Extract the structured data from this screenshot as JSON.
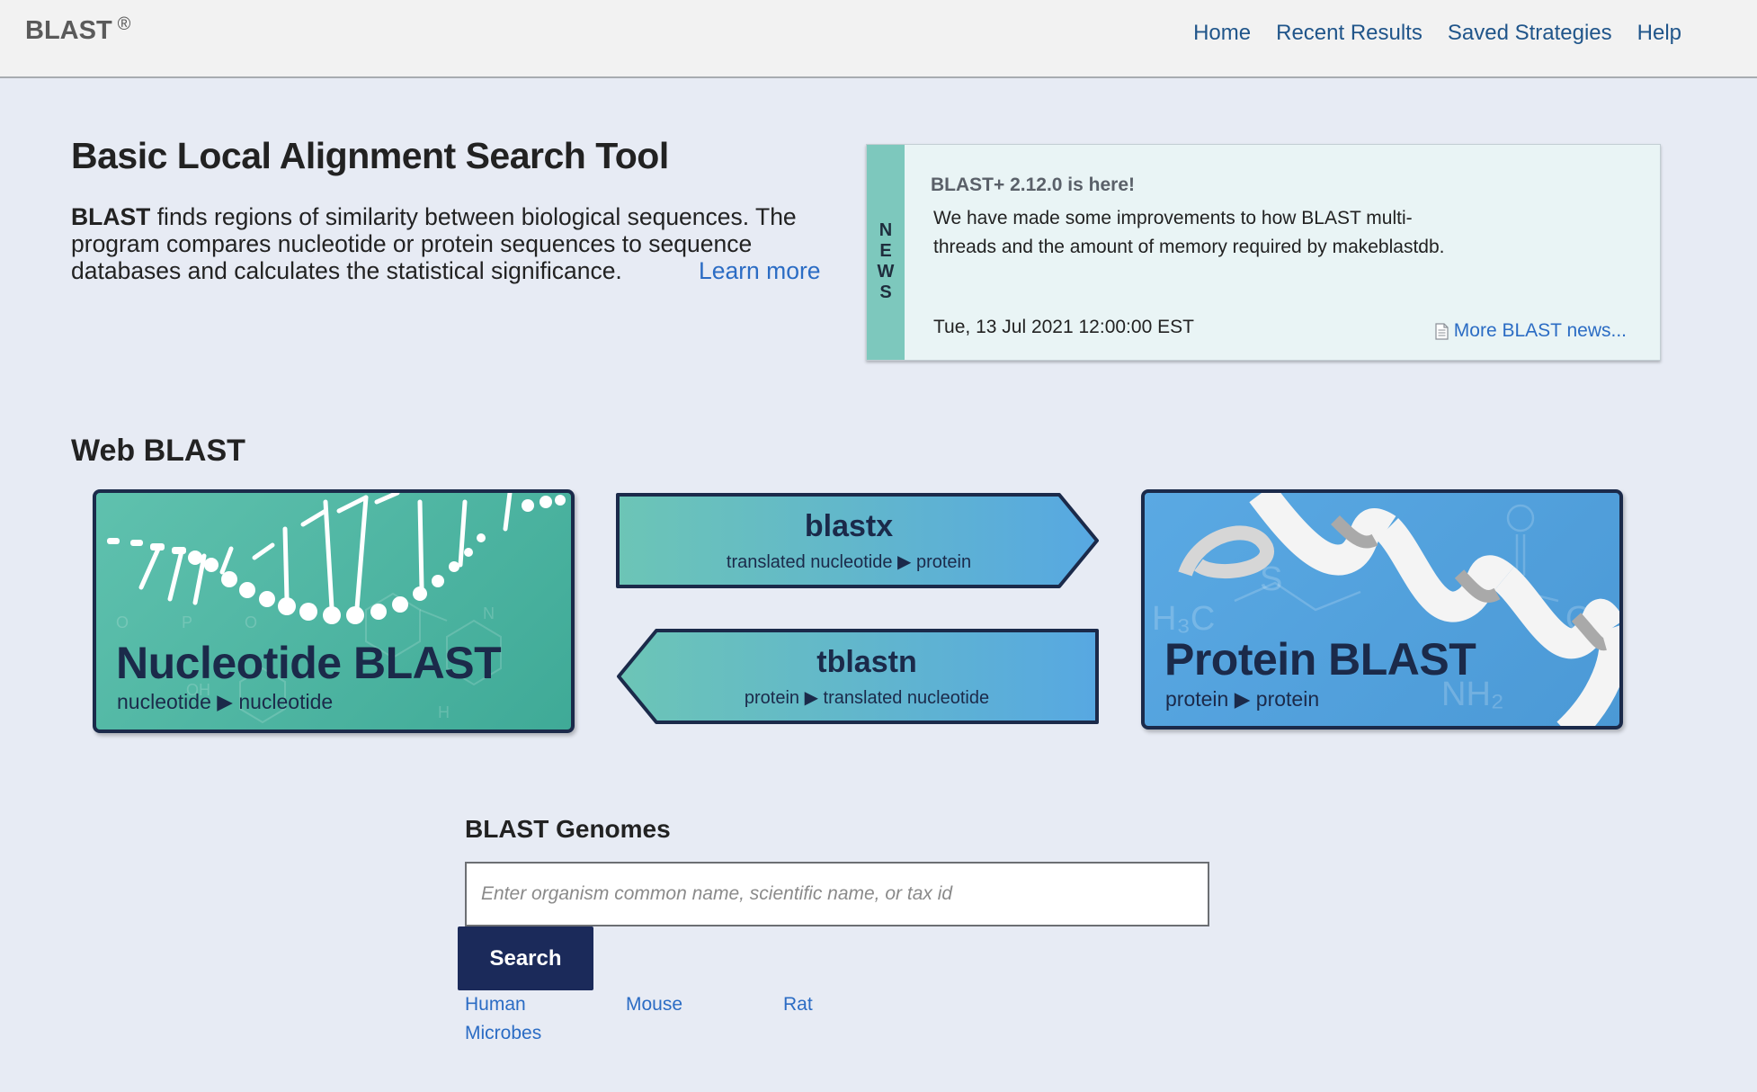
{
  "header": {
    "brand": "BLAST",
    "brand_mark": "®",
    "nav": [
      "Home",
      "Recent Results",
      "Saved Strategies",
      "Help"
    ]
  },
  "intro": {
    "title": "Basic Local Alignment Search Tool",
    "lead_bold": "BLAST",
    "description": " finds regions of similarity between biological sequences. The program compares nucleotide or protein sequences to sequence databases and calculates the statistical significance.",
    "learn_more": "Learn more"
  },
  "news": {
    "label_letters": [
      "N",
      "E",
      "W",
      "S"
    ],
    "headline": "BLAST+ 2.12.0 is here!",
    "body": "We have made some improvements to how BLAST multi-threads and the amount of memory required by makeblastdb.",
    "date": "Tue, 13 Jul 2021 12:00:00 EST",
    "more": "More BLAST news..."
  },
  "web_blast": {
    "title": "Web BLAST",
    "nucleotide": {
      "title": "Nucleotide BLAST",
      "subtitle": "nucleotide ▶ nucleotide"
    },
    "blastx": {
      "title": "blastx",
      "subtitle": "translated nucleotide ▶ protein"
    },
    "tblastn": {
      "title": "tblastn",
      "subtitle": "protein ▶ translated nucleotide"
    },
    "protein": {
      "title": "Protein BLAST",
      "subtitle": "protein ▶ protein"
    }
  },
  "genomes": {
    "title": "BLAST Genomes",
    "placeholder": "Enter organism common name, scientific name, or tax id",
    "search_label": "Search",
    "links": [
      "Human",
      "Mouse",
      "Rat",
      "Microbes"
    ]
  },
  "colors": {
    "nav_link": "#20558a",
    "link": "#2b6cc4",
    "news_band": "#7dc8bd",
    "nucleotide_card": "#4fb6a3",
    "protein_card": "#55a3de",
    "dark_navy": "#1b2a4a",
    "search_button": "#1b2a5a"
  }
}
